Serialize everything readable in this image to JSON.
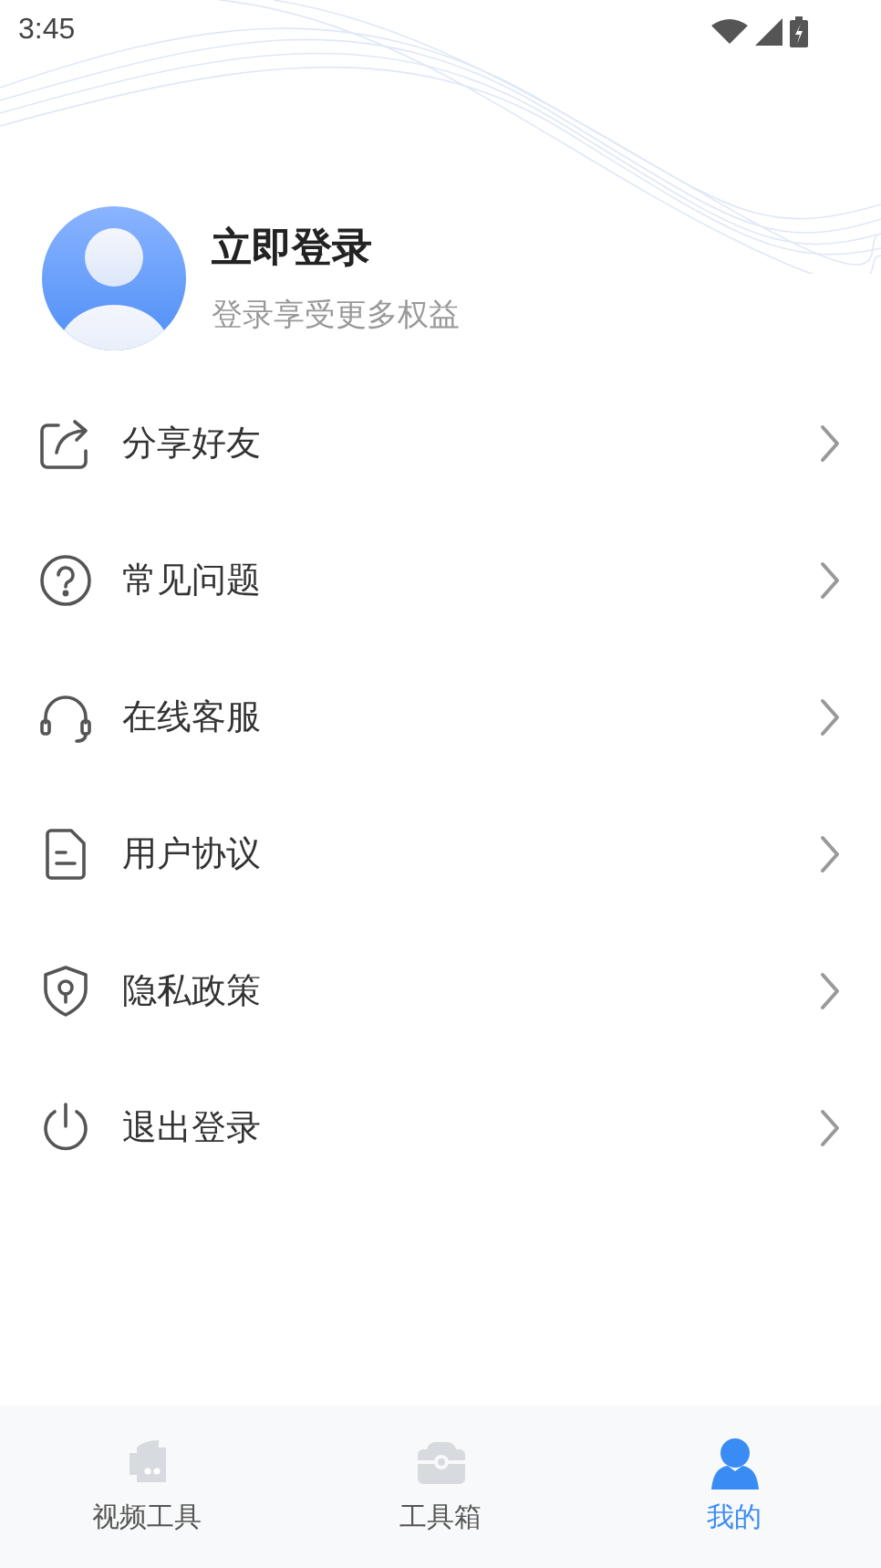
{
  "status_bar": {
    "time": "3:45"
  },
  "profile": {
    "title": "立即登录",
    "subtitle": "登录享受更多权益"
  },
  "menu": [
    {
      "kind": "share",
      "label": "分享好友"
    },
    {
      "kind": "question",
      "label": "常见问题"
    },
    {
      "kind": "headset",
      "label": "在线客服"
    },
    {
      "kind": "document",
      "label": "用户协议"
    },
    {
      "kind": "shield",
      "label": "隐私政策"
    },
    {
      "kind": "power",
      "label": "退出登录"
    }
  ],
  "tab_bar": [
    {
      "kind": "video",
      "label": "视频工具",
      "selected": false
    },
    {
      "kind": "toolbox",
      "label": "工具箱",
      "selected": false
    },
    {
      "kind": "user",
      "label": "我的",
      "selected": true
    }
  ]
}
